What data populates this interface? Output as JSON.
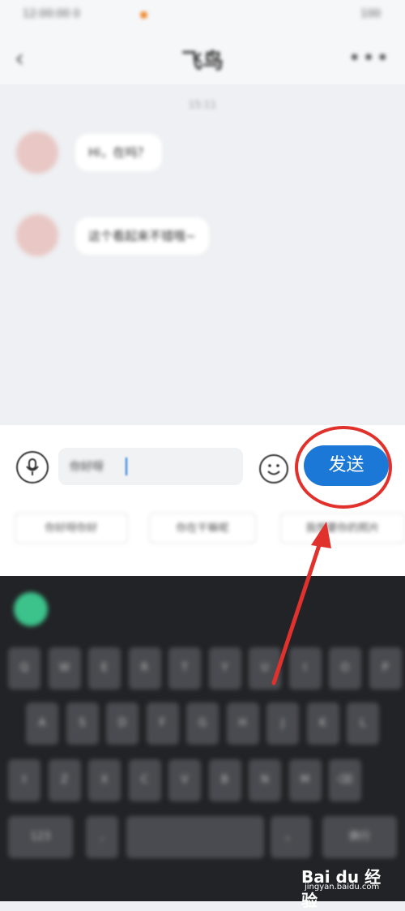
{
  "status_bar": {
    "time": "12:00:00 0",
    "battery": "100"
  },
  "header": {
    "back_icon": "chevron-left-icon",
    "title": "飞鸟",
    "more_icon": "more-icon"
  },
  "chat": {
    "timestamp": "15:11",
    "messages": [
      {
        "text": "Hi，在吗？"
      },
      {
        "text": "这个看起来不错哦~"
      }
    ]
  },
  "composer": {
    "mic_icon": "mic-icon",
    "input_value": "你好呀",
    "emoji_icon": "emoji-icon",
    "send_label": "发送"
  },
  "quick_replies": [
    {
      "label": "你好呀你好"
    },
    {
      "label": "你在干嘛呢"
    },
    {
      "label": "我想要你的照片"
    }
  ],
  "keyboard": {
    "rows": [
      [
        "Q",
        "W",
        "E",
        "R",
        "T",
        "Y",
        "U",
        "I",
        "O",
        "P"
      ],
      [
        "A",
        "S",
        "D",
        "F",
        "G",
        "H",
        "J",
        "K",
        "L"
      ],
      [
        "⇧",
        "Z",
        "X",
        "C",
        "V",
        "B",
        "N",
        "M",
        "⌫"
      ],
      [
        "123",
        ",",
        "",
        "。",
        "换行"
      ]
    ]
  },
  "watermark": {
    "brand": "Bai du 经验",
    "sub": "jingyan.baidu.com"
  },
  "colors": {
    "accent": "#1c78d6",
    "highlight": "#e0312c"
  }
}
